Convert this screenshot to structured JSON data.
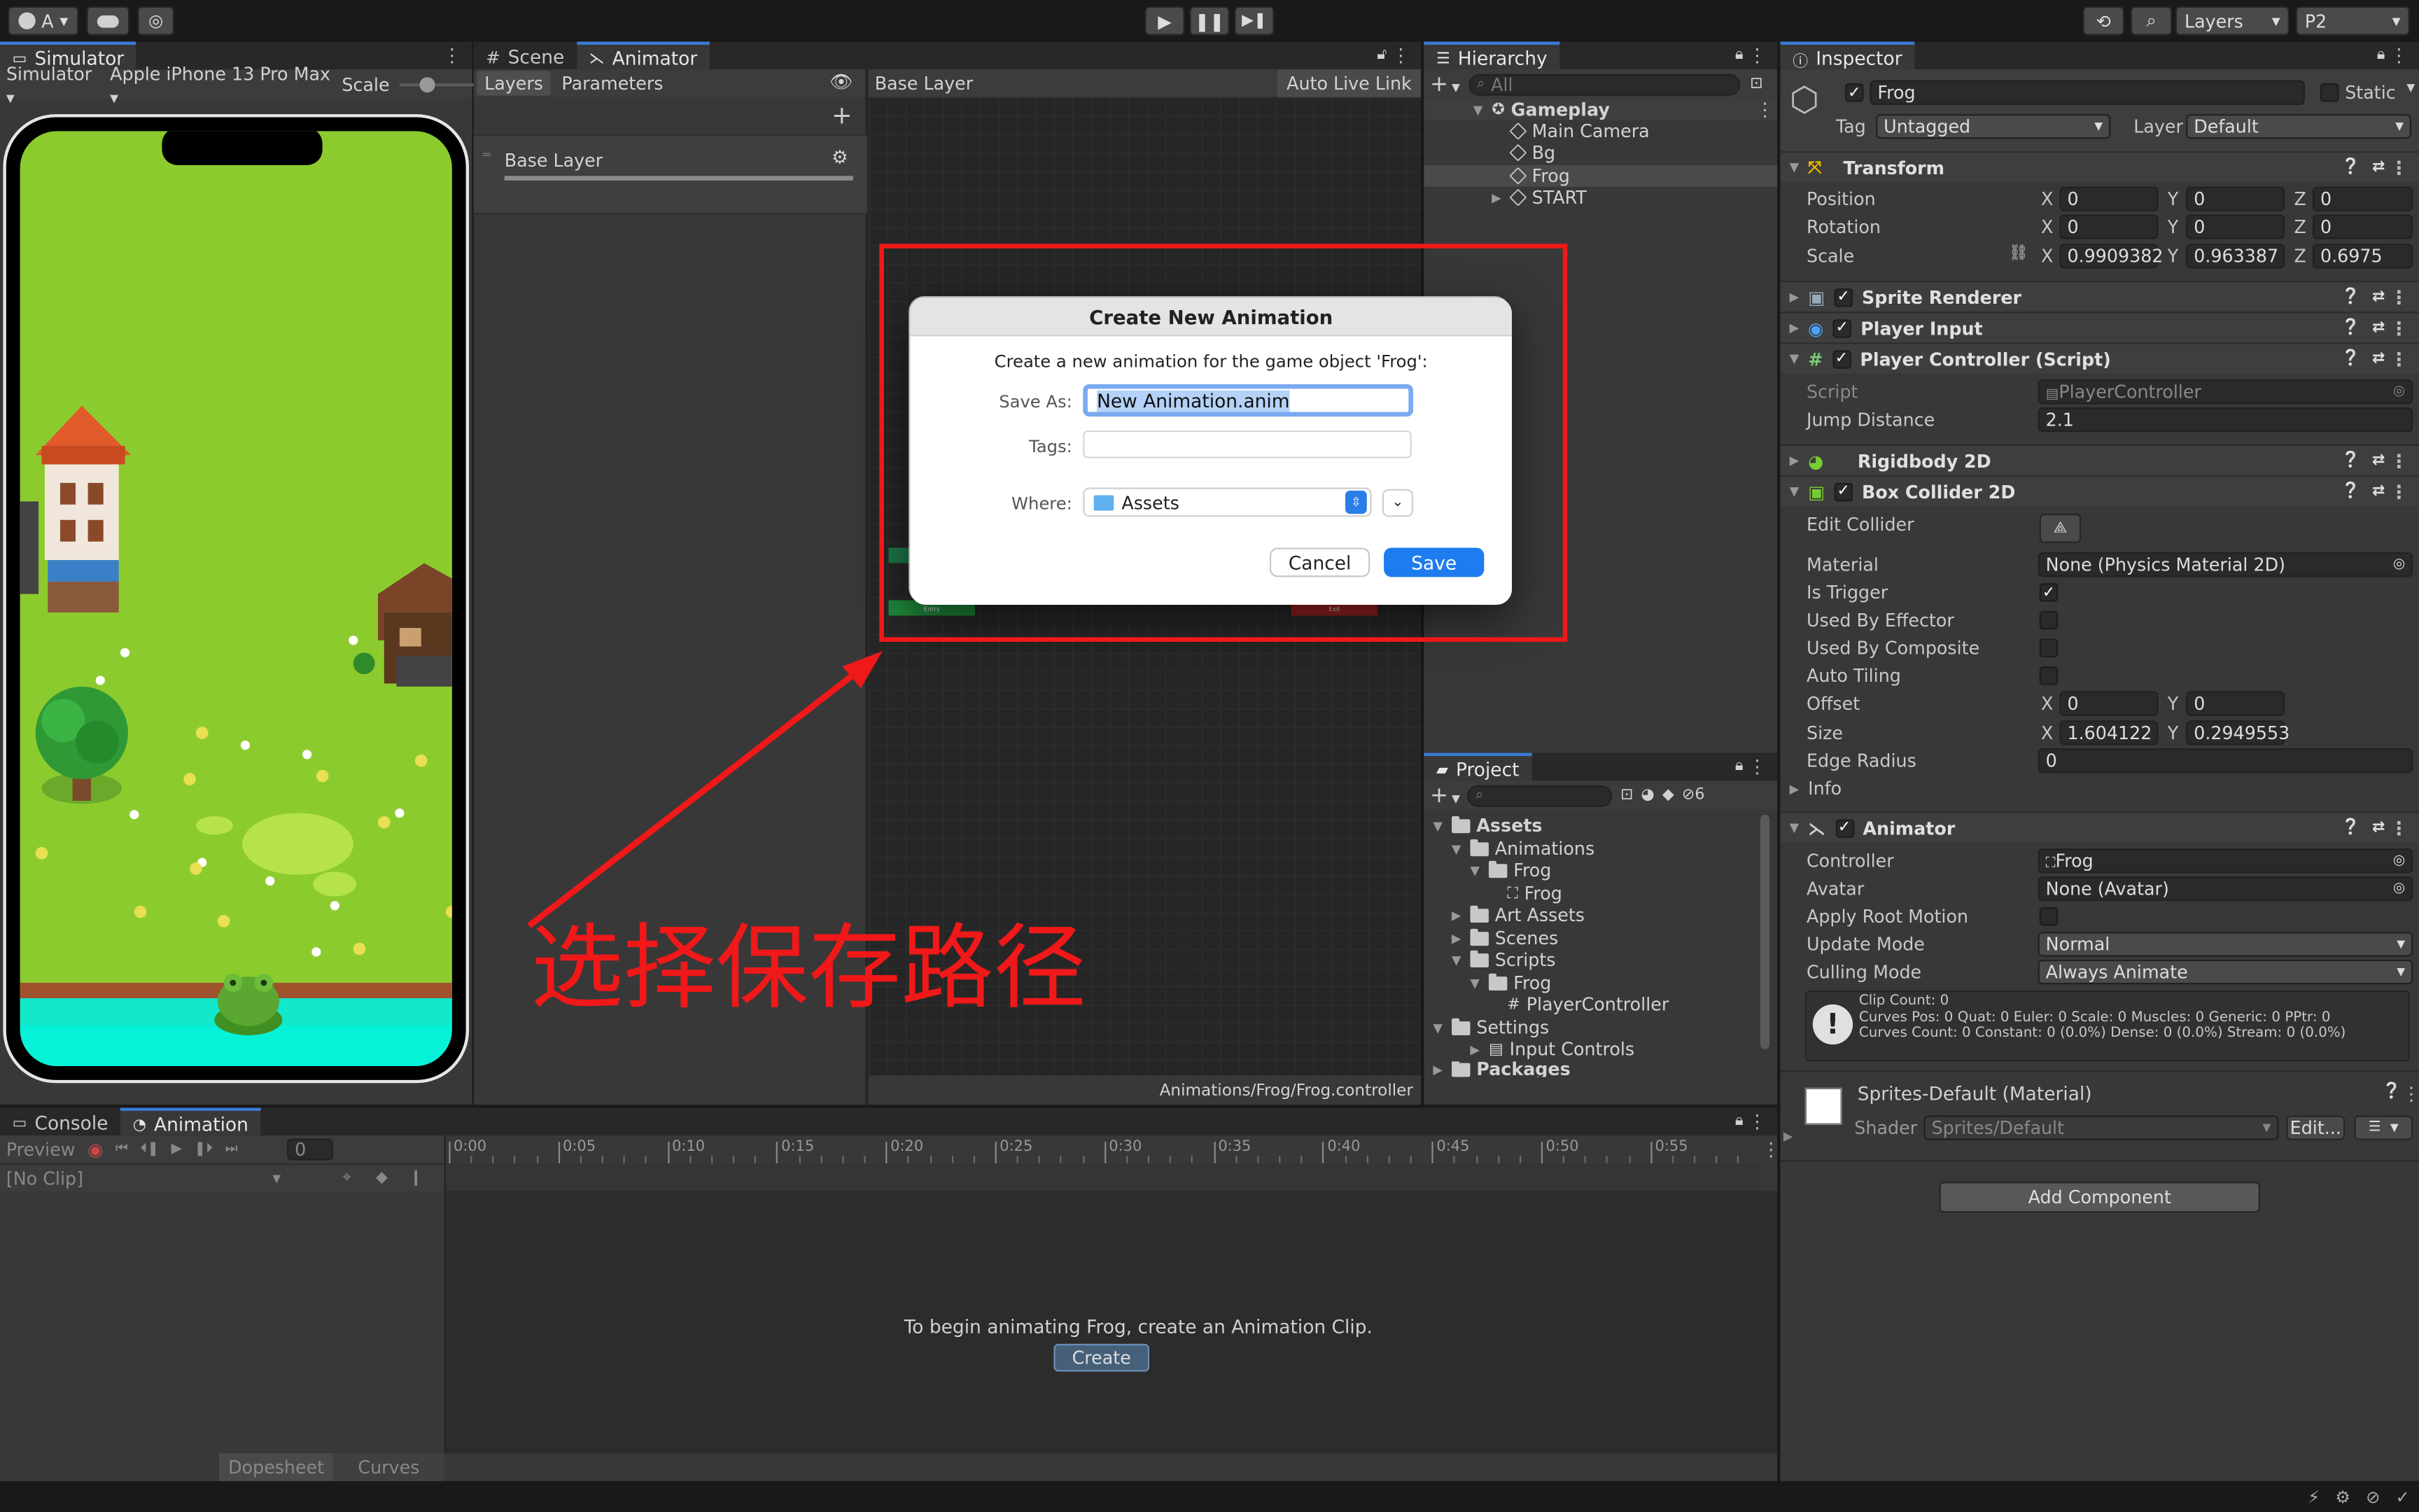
{
  "toolbar": {
    "account": "A",
    "layers_label": "Layers",
    "layout_label": "P2"
  },
  "simulator": {
    "tab": "Simulator",
    "mode": "Simulator",
    "device": "Apple iPhone 13 Pro Max",
    "scale_label": "Scale"
  },
  "animator": {
    "tab_scene": "Scene",
    "tab_animator": "Animator",
    "tab_layers": "Layers",
    "tab_parameters": "Parameters",
    "breadcrumb": "Base Layer",
    "auto_live_link": "Auto Live Link",
    "layer_name": "Base Layer",
    "footer_path": "Animations/Frog/Frog.controller",
    "entry": "Entry",
    "exit": "Exit"
  },
  "dialog": {
    "title": "Create New Animation",
    "message": "Create a new animation for the game object 'Frog':",
    "save_as_label": "Save As:",
    "save_as_value": "New Animation.anim",
    "tags_label": "Tags:",
    "tags_value": "",
    "where_label": "Where:",
    "where_value": "Assets",
    "cancel": "Cancel",
    "save": "Save"
  },
  "annotation": {
    "text": "选择保存路径",
    "color": "#f01818"
  },
  "hierarchy": {
    "tab": "Hierarchy",
    "search_placeholder": "All",
    "items": [
      {
        "label": "Gameplay"
      },
      {
        "label": "Main Camera"
      },
      {
        "label": "Bg"
      },
      {
        "label": "Frog"
      },
      {
        "label": "START"
      }
    ]
  },
  "project": {
    "tab": "Project",
    "count": "6",
    "items": [
      {
        "label": "Assets"
      },
      {
        "label": "Animations"
      },
      {
        "label": "Frog"
      },
      {
        "label": "Frog"
      },
      {
        "label": "Art Assets"
      },
      {
        "label": "Scenes"
      },
      {
        "label": "Scripts"
      },
      {
        "label": "Frog"
      },
      {
        "label": "PlayerController"
      },
      {
        "label": "Settings"
      },
      {
        "label": "Input Controls"
      },
      {
        "label": "Packages"
      }
    ]
  },
  "inspector": {
    "tab": "Inspector",
    "object_name": "Frog",
    "static_label": "Static",
    "tag_label": "Tag",
    "tag_value": "Untagged",
    "layer_label": "Layer",
    "layer_value": "Default",
    "transform": {
      "title": "Transform",
      "position_label": "Position",
      "rotation_label": "Rotation",
      "scale_label": "Scale",
      "pos_x": "0",
      "pos_y": "0",
      "pos_z": "0",
      "rot_x": "0",
      "rot_y": "0",
      "rot_z": "0",
      "scale_x": "0.9909382",
      "scale_y": "0.963387",
      "scale_z": "0.6975"
    },
    "sprite_renderer": "Sprite Renderer",
    "player_input": "Player Input",
    "player_controller": {
      "title": "Player Controller (Script)",
      "script_label": "Script",
      "script_value": "PlayerController",
      "jump_label": "Jump Distance",
      "jump_value": "2.1"
    },
    "rigidbody": "Rigidbody 2D",
    "box_collider": {
      "title": "Box Collider 2D",
      "edit_collider": "Edit Collider",
      "material_label": "Material",
      "material_value": "None (Physics Material 2D)",
      "is_trigger": "Is Trigger",
      "used_by_effector": "Used By Effector",
      "used_by_composite": "Used By Composite",
      "auto_tiling": "Auto Tiling",
      "offset_label": "Offset",
      "offset_x": "0",
      "offset_y": "0",
      "size_label": "Size",
      "size_x": "1.604122",
      "size_y": "0.2949553",
      "edge_radius_label": "Edge Radius",
      "edge_radius_value": "0",
      "info_label": "Info"
    },
    "animator_comp": {
      "title": "Animator",
      "controller_label": "Controller",
      "controller_value": "Frog",
      "avatar_label": "Avatar",
      "avatar_value": "None (Avatar)",
      "root_motion_label": "Apply Root Motion",
      "update_mode_label": "Update Mode",
      "update_mode_value": "Normal",
      "culling_mode_label": "Culling Mode",
      "culling_mode_value": "Always Animate",
      "info_line1": "Clip Count: 0",
      "info_line2": "Curves Pos: 0 Quat: 0 Euler: 0 Scale: 0 Muscles: 0 Generic: 0 PPtr: 0",
      "info_line3": "Curves Count: 0 Constant: 0 (0.0%) Dense: 0 (0.0%) Stream: 0 (0.0%)"
    },
    "material": {
      "title": "Sprites-Default (Material)",
      "shader_label": "Shader",
      "shader_value": "Sprites/Default",
      "edit": "Edit..."
    },
    "add_component": "Add Component"
  },
  "animation": {
    "tab_console": "Console",
    "tab_animation": "Animation",
    "preview": "Preview",
    "frame": "0",
    "clip": "[No Clip]",
    "timeline": [
      "0:00",
      "0:05",
      "0:10",
      "0:15",
      "0:20",
      "0:25",
      "0:30",
      "0:35",
      "0:40",
      "0:45",
      "0:50",
      "0:55"
    ],
    "empty_message": "To begin animating Frog, create an Animation Clip.",
    "create": "Create",
    "dopesheet": "Dopesheet",
    "curves": "Curves"
  }
}
